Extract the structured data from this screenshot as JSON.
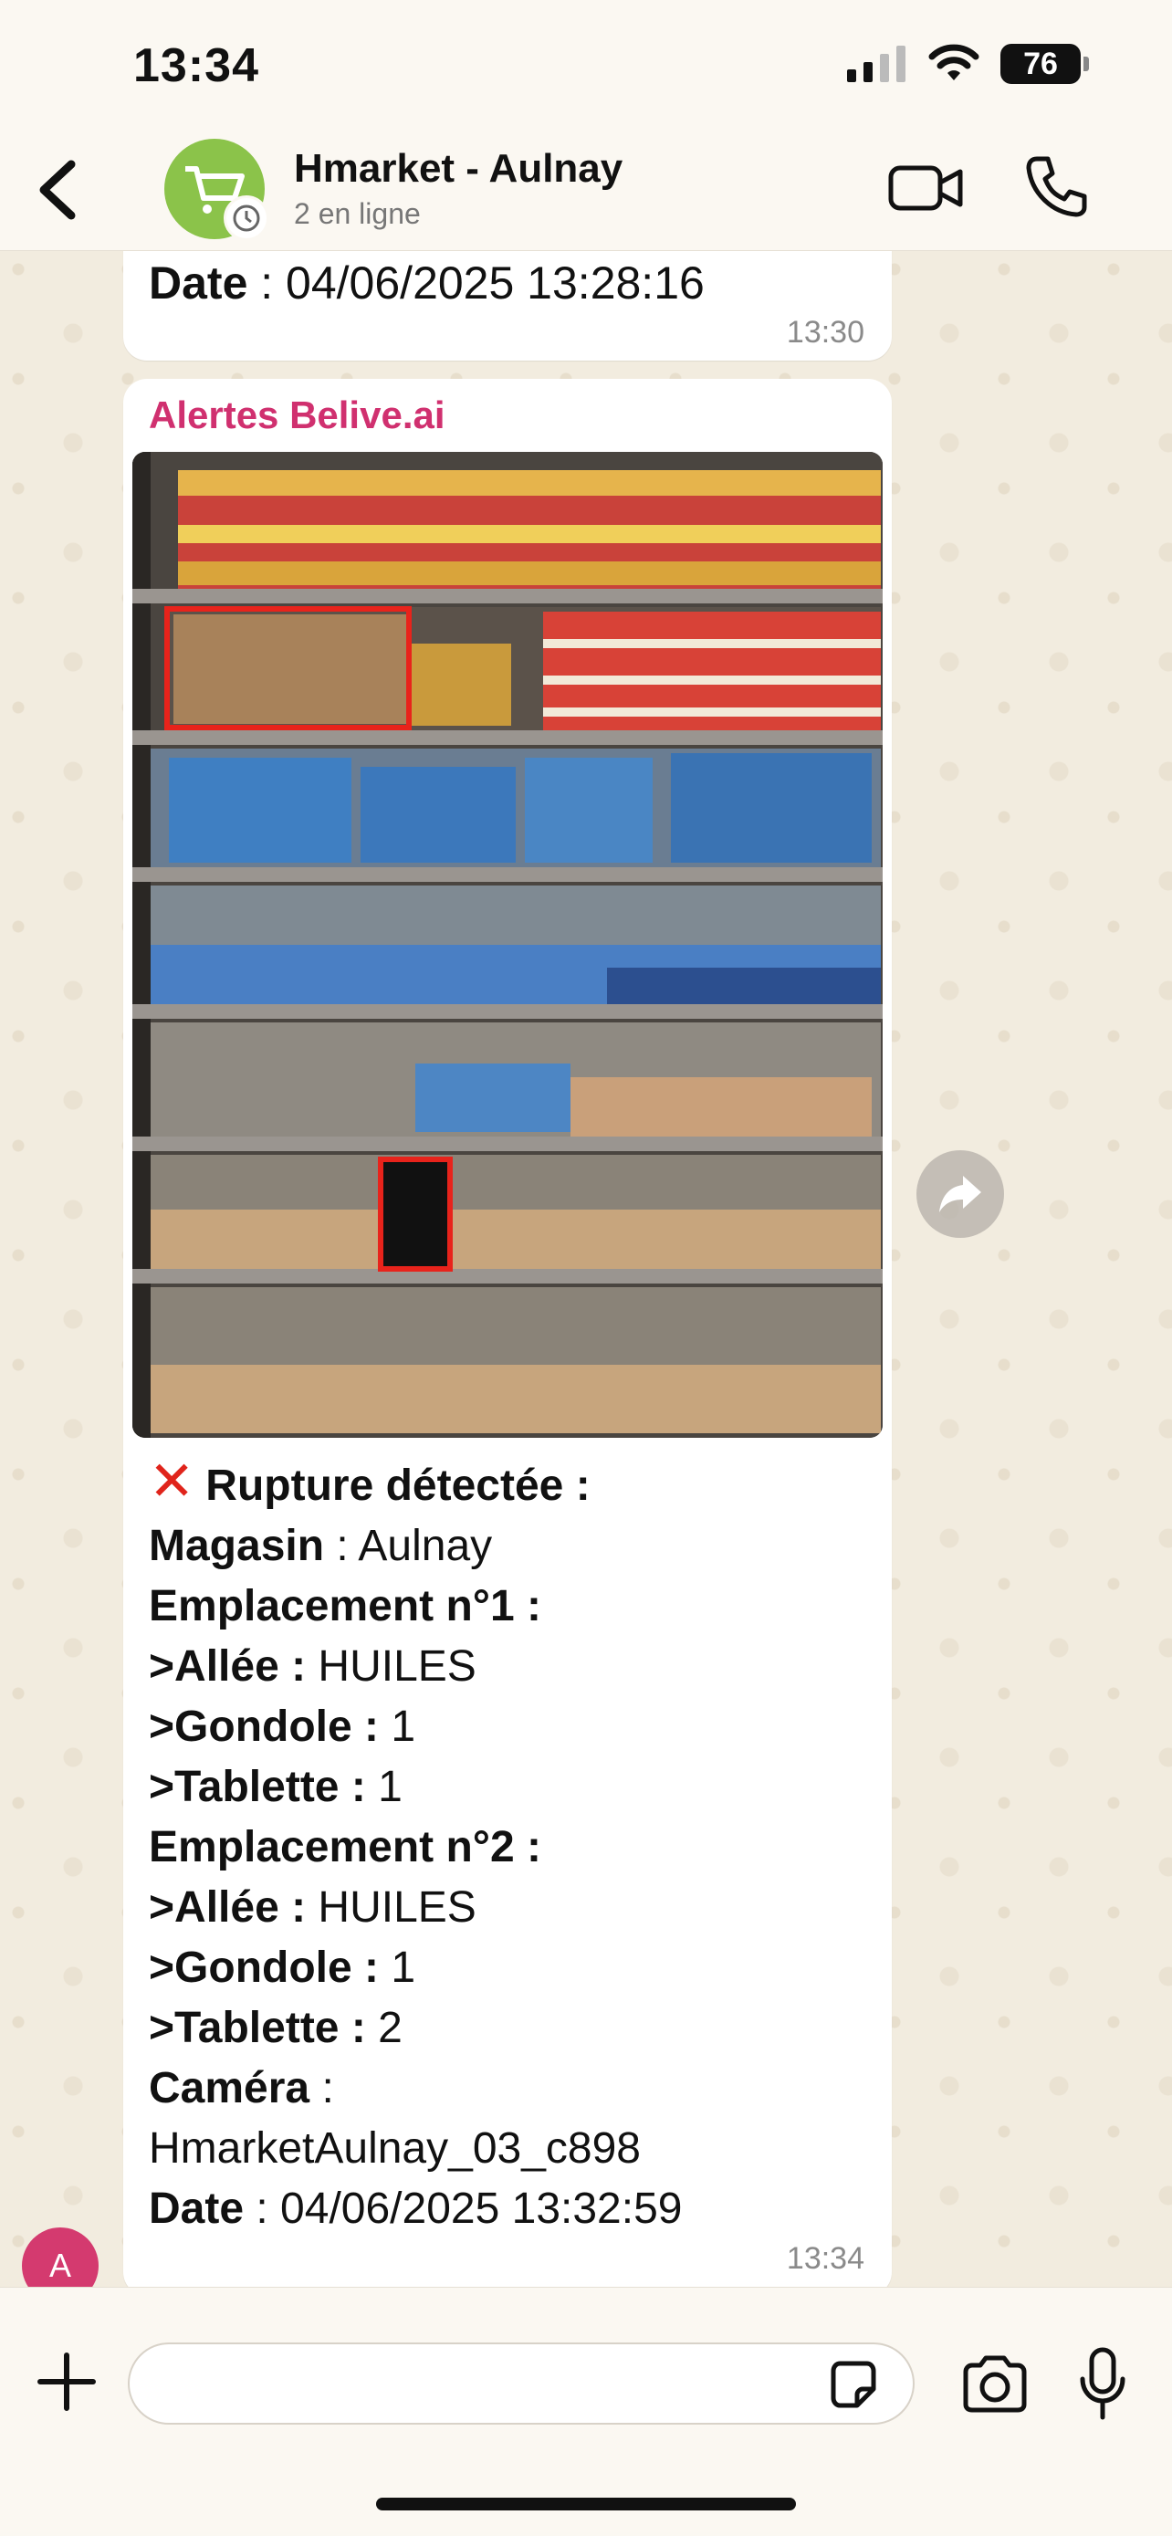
{
  "status_bar": {
    "time": "13:34",
    "battery": "76"
  },
  "header": {
    "title": "Hmarket - Aulnay",
    "subtitle": "2 en ligne"
  },
  "previous_message": {
    "date_label": "Date",
    "date_value": " : 04/06/2025 13:28:16",
    "time": "13:30"
  },
  "message": {
    "sender": "Alertes Belive.ai",
    "heading": "Rupture détectée",
    "heading_suffix": " :",
    "store_label": "Magasin",
    "store_value": " : Aulnay",
    "location1_label": "Emplacement n°1 :",
    "location1_aisle_label": " >Allée :",
    "location1_aisle_value": " HUILES",
    "location1_gondola_label": " >Gondole :",
    "location1_gondola_value": " 1",
    "location1_shelf_label": " >Tablette :",
    "location1_shelf_value": " 1",
    "location2_label": "Emplacement n°2 :",
    "location2_aisle_label": " >Allée :",
    "location2_aisle_value": " HUILES",
    "location2_gondola_label": " >Gondole :",
    "location2_gondola_value": " 1",
    "location2_shelf_label": " >Tablette :",
    "location2_shelf_value": " 2",
    "camera_label": "Caméra",
    "camera_sep": " :",
    "camera_value": "HmarketAulnay_03_c898",
    "date_label": "Date",
    "date_value": " : 04/06/2025 13:32:59",
    "time": "13:34"
  },
  "user_avatar_initial": "A",
  "input": {
    "placeholder": ""
  },
  "colors": {
    "sender": "#d0306f",
    "alert_box": "#e8231b",
    "avatar_green": "#8bc34a",
    "user_avatar": "#d43a6f"
  }
}
